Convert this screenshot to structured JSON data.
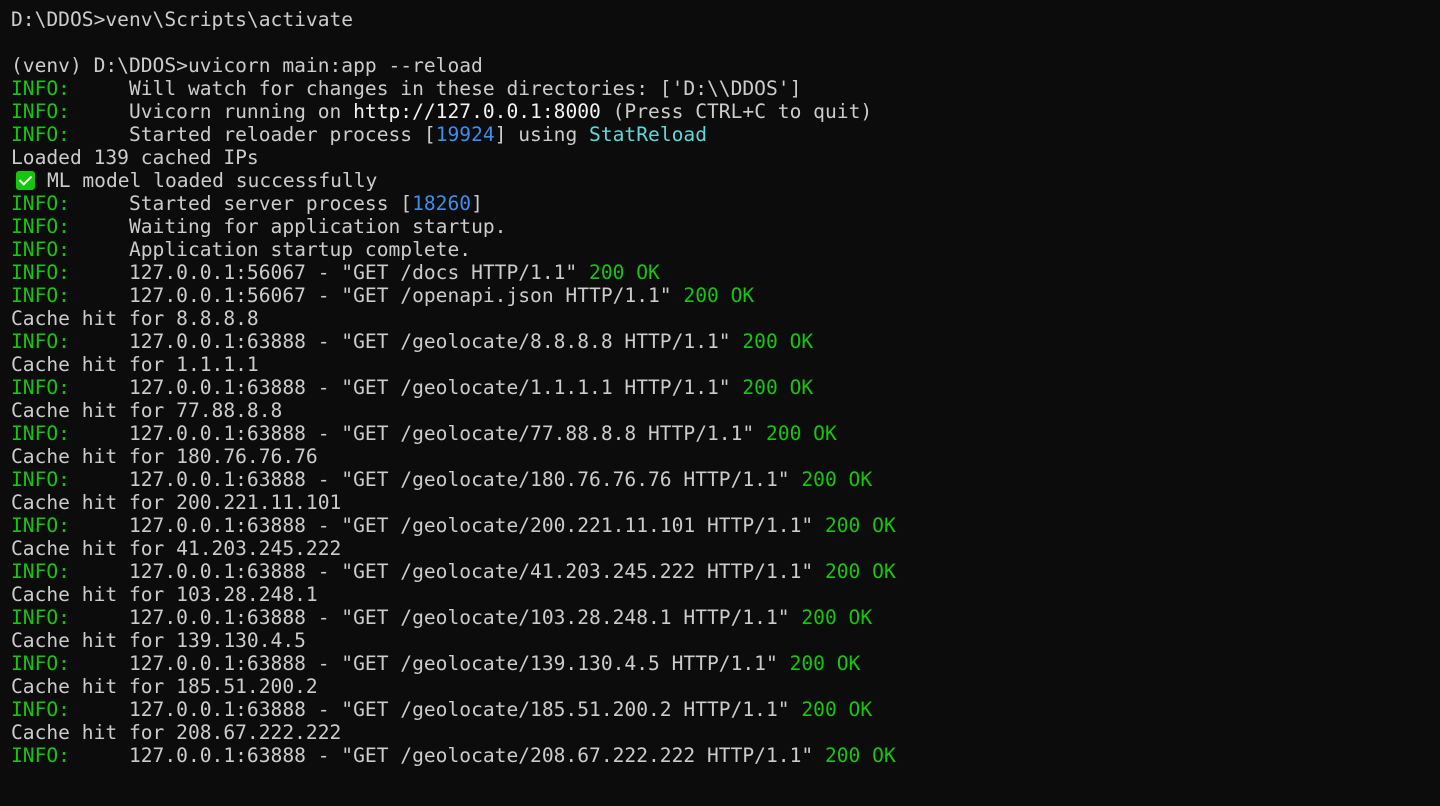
{
  "terminal": {
    "colors": {
      "background": "#0c0c0c",
      "foreground": "#cccccc",
      "info_green": "#16c60c",
      "pid_blue": "#3b8eea",
      "cyan": "#61d6d6"
    },
    "lines": [
      {
        "kind": "text",
        "text": "D:\\DDOS>venv\\Scripts\\activate"
      },
      {
        "kind": "blank"
      },
      {
        "kind": "text",
        "text": "(venv) D:\\DDOS>uvicorn main:app --reload"
      },
      {
        "kind": "info",
        "parts": [
          {
            "text": "Will watch for changes in these directories: ['D:\\\\DDOS']"
          }
        ]
      },
      {
        "kind": "info",
        "parts": [
          {
            "text": "Uvicorn running on "
          },
          {
            "text": "http://127.0.0.1:8000",
            "style": "bright"
          },
          {
            "text": " (Press CTRL+C to quit)"
          }
        ]
      },
      {
        "kind": "info",
        "parts": [
          {
            "text": "Started reloader process ["
          },
          {
            "text": "19924",
            "style": "pid"
          },
          {
            "text": "] using "
          },
          {
            "text": "StatReload",
            "style": "cyan"
          }
        ]
      },
      {
        "kind": "text",
        "text": "Loaded 139 cached IPs"
      },
      {
        "kind": "check",
        "text": "ML model loaded successfully",
        "icon": "check-mark-icon"
      },
      {
        "kind": "info",
        "parts": [
          {
            "text": "Started server process ["
          },
          {
            "text": "18260",
            "style": "pid"
          },
          {
            "text": "]"
          }
        ]
      },
      {
        "kind": "info",
        "parts": [
          {
            "text": "Waiting for application startup."
          }
        ]
      },
      {
        "kind": "info",
        "parts": [
          {
            "text": "Application startup complete."
          }
        ]
      },
      {
        "kind": "info",
        "parts": [
          {
            "text": "127.0.0.1:56067 - \"GET /docs HTTP/1.1\" "
          },
          {
            "text": "200 OK",
            "style": "ok"
          }
        ]
      },
      {
        "kind": "info",
        "parts": [
          {
            "text": "127.0.0.1:56067 - \"GET /openapi.json HTTP/1.1\" "
          },
          {
            "text": "200 OK",
            "style": "ok"
          }
        ]
      },
      {
        "kind": "text",
        "text": "Cache hit for 8.8.8.8"
      },
      {
        "kind": "info",
        "parts": [
          {
            "text": "127.0.0.1:63888 - \"GET /geolocate/8.8.8.8 HTTP/1.1\" "
          },
          {
            "text": "200 OK",
            "style": "ok"
          }
        ]
      },
      {
        "kind": "text",
        "text": "Cache hit for 1.1.1.1"
      },
      {
        "kind": "info",
        "parts": [
          {
            "text": "127.0.0.1:63888 - \"GET /geolocate/1.1.1.1 HTTP/1.1\" "
          },
          {
            "text": "200 OK",
            "style": "ok"
          }
        ]
      },
      {
        "kind": "text",
        "text": "Cache hit for 77.88.8.8"
      },
      {
        "kind": "info",
        "parts": [
          {
            "text": "127.0.0.1:63888 - \"GET /geolocate/77.88.8.8 HTTP/1.1\" "
          },
          {
            "text": "200 OK",
            "style": "ok"
          }
        ]
      },
      {
        "kind": "text",
        "text": "Cache hit for 180.76.76.76"
      },
      {
        "kind": "info",
        "parts": [
          {
            "text": "127.0.0.1:63888 - \"GET /geolocate/180.76.76.76 HTTP/1.1\" "
          },
          {
            "text": "200 OK",
            "style": "ok"
          }
        ]
      },
      {
        "kind": "text",
        "text": "Cache hit for 200.221.11.101"
      },
      {
        "kind": "info",
        "parts": [
          {
            "text": "127.0.0.1:63888 - \"GET /geolocate/200.221.11.101 HTTP/1.1\" "
          },
          {
            "text": "200 OK",
            "style": "ok"
          }
        ]
      },
      {
        "kind": "text",
        "text": "Cache hit for 41.203.245.222"
      },
      {
        "kind": "info",
        "parts": [
          {
            "text": "127.0.0.1:63888 - \"GET /geolocate/41.203.245.222 HTTP/1.1\" "
          },
          {
            "text": "200 OK",
            "style": "ok"
          }
        ]
      },
      {
        "kind": "text",
        "text": "Cache hit for 103.28.248.1"
      },
      {
        "kind": "info",
        "parts": [
          {
            "text": "127.0.0.1:63888 - \"GET /geolocate/103.28.248.1 HTTP/1.1\" "
          },
          {
            "text": "200 OK",
            "style": "ok"
          }
        ]
      },
      {
        "kind": "text",
        "text": "Cache hit for 139.130.4.5"
      },
      {
        "kind": "info",
        "parts": [
          {
            "text": "127.0.0.1:63888 - \"GET /geolocate/139.130.4.5 HTTP/1.1\" "
          },
          {
            "text": "200 OK",
            "style": "ok"
          }
        ]
      },
      {
        "kind": "text",
        "text": "Cache hit for 185.51.200.2"
      },
      {
        "kind": "info",
        "parts": [
          {
            "text": "127.0.0.1:63888 - \"GET /geolocate/185.51.200.2 HTTP/1.1\" "
          },
          {
            "text": "200 OK",
            "style": "ok"
          }
        ]
      },
      {
        "kind": "text",
        "text": "Cache hit for 208.67.222.222"
      },
      {
        "kind": "info",
        "parts": [
          {
            "text": "127.0.0.1:63888 - \"GET /geolocate/208.67.222.222 HTTP/1.1\" "
          },
          {
            "text": "200 OK",
            "style": "ok"
          }
        ]
      }
    ],
    "info_label": "INFO:",
    "info_padding": "     "
  }
}
